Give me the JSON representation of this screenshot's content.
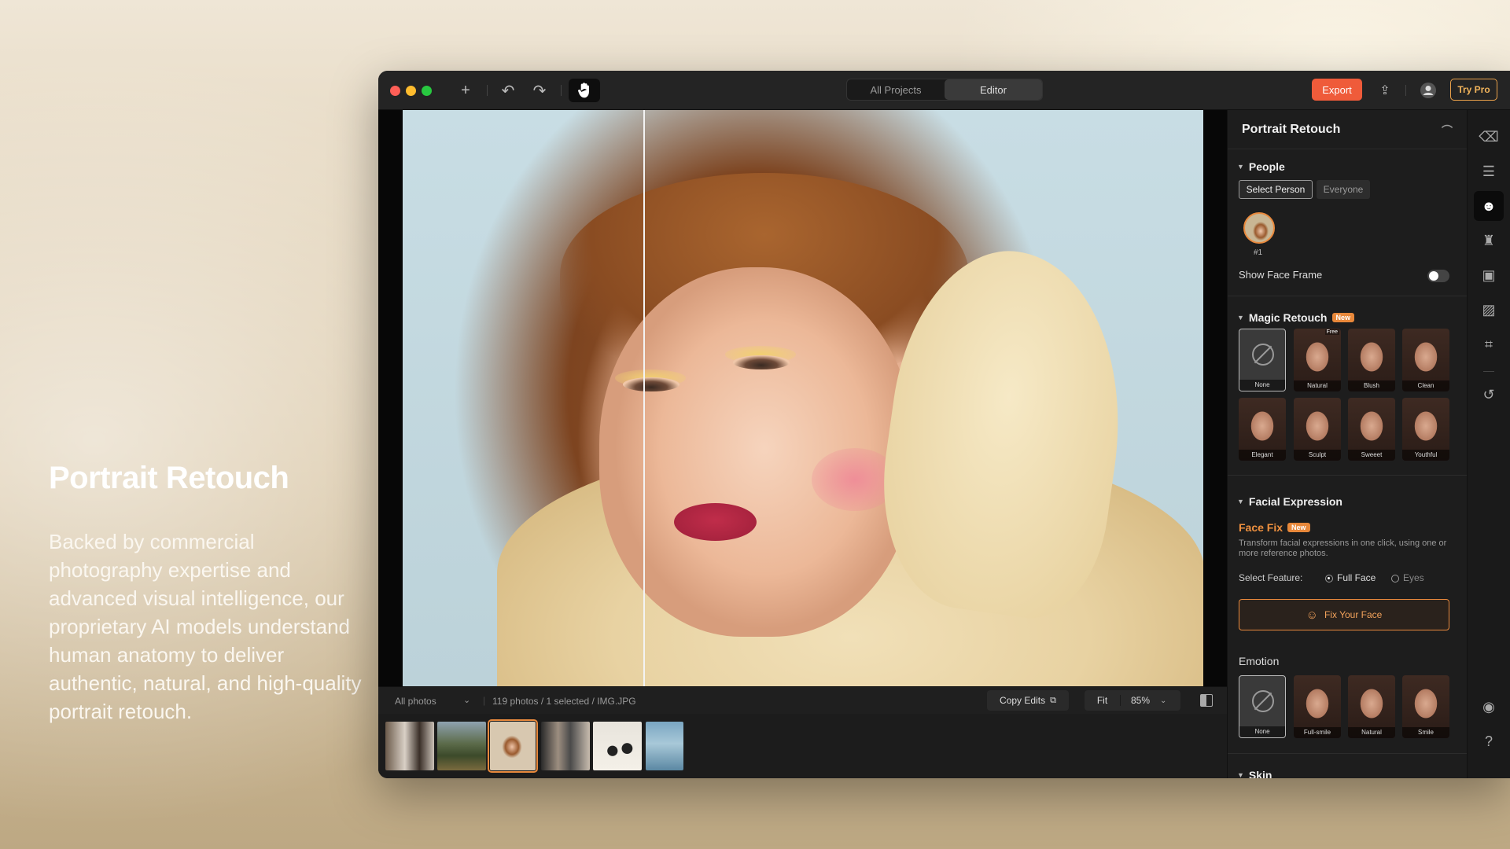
{
  "promo": {
    "title": "Portrait Retouch",
    "body": "Backed by commercial photography expertise and advanced visual intelligence, our proprietary AI models understand human anatomy to deliver authentic, natural, and high-quality portrait retouch."
  },
  "titlebar": {
    "tabs": [
      "All Projects",
      "Editor"
    ],
    "active_tab": "Editor",
    "export_label": "Export",
    "trypro_label": "Try Pro",
    "icons": [
      "add-icon",
      "undo-icon",
      "redo-icon",
      "hand-icon",
      "import-icon",
      "account-icon"
    ]
  },
  "filmstrip": {
    "filter": "All photos",
    "info": "119 photos / 1 selected / IMG.JPG",
    "copy_edits": "Copy Edits",
    "fit": "Fit",
    "zoom": "85%"
  },
  "panel": {
    "title": "Portrait Retouch",
    "people": {
      "header": "People",
      "select_person": "Select Person",
      "everyone": "Everyone",
      "person_tag": "#1",
      "show_face_frame": "Show Face Frame",
      "show_face_frame_on": false
    },
    "magic": {
      "header": "Magic Retouch",
      "badge": "New",
      "free_tag": "Free",
      "presets": [
        "None",
        "Natural",
        "Blush",
        "Clean",
        "Elegant",
        "Sculpt",
        "Sweeet",
        "Youthful"
      ],
      "selected": "None"
    },
    "facial": {
      "header": "Facial Expression",
      "facefix_title": "Face Fix",
      "facefix_badge": "New",
      "facefix_desc": "Transform facial expressions in one click, using one or more reference photos.",
      "select_feature_label": "Select Feature:",
      "feature_full": "Full Face",
      "feature_eyes": "Eyes",
      "selected_feature": "Full Face",
      "fix_button": "Fix Your Face",
      "emotion_label": "Emotion",
      "emotions": [
        "None",
        "Full-smile",
        "Natural",
        "Smile"
      ]
    },
    "next_section": "Skin"
  },
  "rail_icons": [
    "eraser-icon",
    "sliders-icon",
    "portrait-retouch-icon",
    "body-icon",
    "image-ai-icon",
    "pattern-icon",
    "crop-icon",
    "history-icon",
    "discord-icon",
    "help-icon"
  ],
  "colors": {
    "accent": "#ef5b3a",
    "pro": "#e9a04a"
  }
}
